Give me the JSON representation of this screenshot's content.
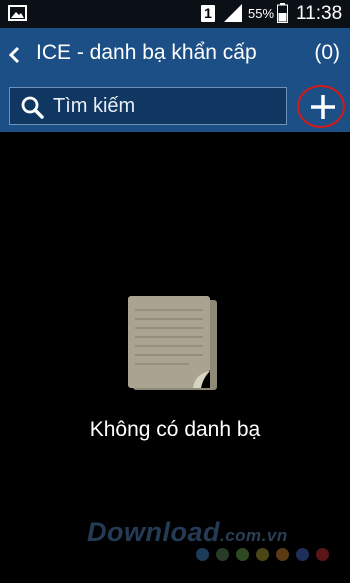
{
  "status_bar": {
    "sim_slot": "1",
    "battery_percent": "55%",
    "time": "11:38"
  },
  "action_bar": {
    "title": "ICE - danh bạ khẩn cấp",
    "count": "(0)"
  },
  "search": {
    "placeholder": "Tìm kiếm"
  },
  "empty_state": {
    "message": "Không có danh bạ"
  },
  "watermark": {
    "brand": "Download",
    "domain": ".com.vn",
    "dot_colors": [
      "#1d3c5a",
      "#2a3a2a",
      "#2f4a22",
      "#4a4616",
      "#5a3a12",
      "#1d2f5a",
      "#5a1616"
    ]
  }
}
